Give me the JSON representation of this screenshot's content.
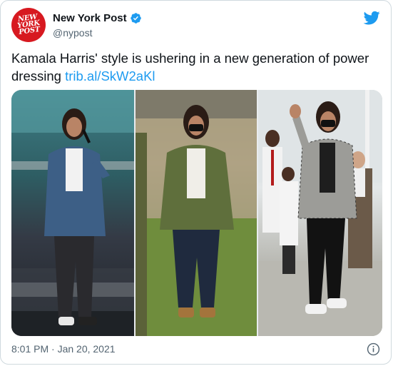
{
  "account": {
    "display_name": "New York Post",
    "handle": "@nypost",
    "avatar_text_lines": [
      "NEW",
      "YORK",
      "POST"
    ],
    "verified_icon": "verified-badge-icon",
    "brand_color": "#d71920"
  },
  "tweet": {
    "text": "Kamala Harris' style is ushering in a new generation of power dressing ",
    "link": "trib.al/SkW2aKl",
    "link_color": "#1d9bf0"
  },
  "media": {
    "photos": [
      {
        "label": "photo-stage-navy-blazer"
      },
      {
        "label": "photo-field-olive-jacket"
      },
      {
        "label": "photo-waving-houndstooth-blazer"
      }
    ]
  },
  "footer": {
    "timestamp": "8:01 PM · Jan 20, 2021",
    "info_icon": "info-icon"
  },
  "icons": {
    "platform": "twitter-bird-icon",
    "platform_color": "#1d9bf0"
  }
}
